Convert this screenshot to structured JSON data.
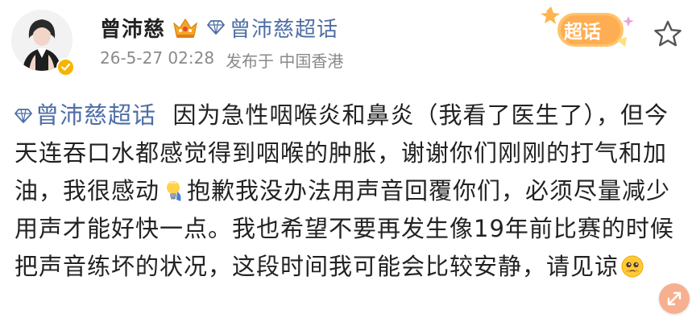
{
  "user": {
    "name": "曾沛慈",
    "timestamp": "26-5-27 02:28",
    "location": "发布于 中国香港"
  },
  "topic": {
    "name": "曾沛慈超话"
  },
  "supertopic_button": {
    "label": "超话"
  },
  "post": {
    "topic_tag": "曾沛慈超话",
    "segments": [
      "因为急性咽喉炎和鼻炎（我看了医生了），但今天连吞口水都感觉得到咽喉的肿胀，谢谢你们刚刚的打气和加油，我很感动",
      "抱歉我没办法用声音回覆你们，必须尽量减少用声才能好快一点。我也希望不要再发生像19年前比赛的时候把声音练坏的状况，这段时间我可能会比较安静，请见谅"
    ]
  },
  "colors": {
    "link": "#4e6ea5",
    "meta": "#8a8a8a",
    "verified": "#f6b400"
  }
}
